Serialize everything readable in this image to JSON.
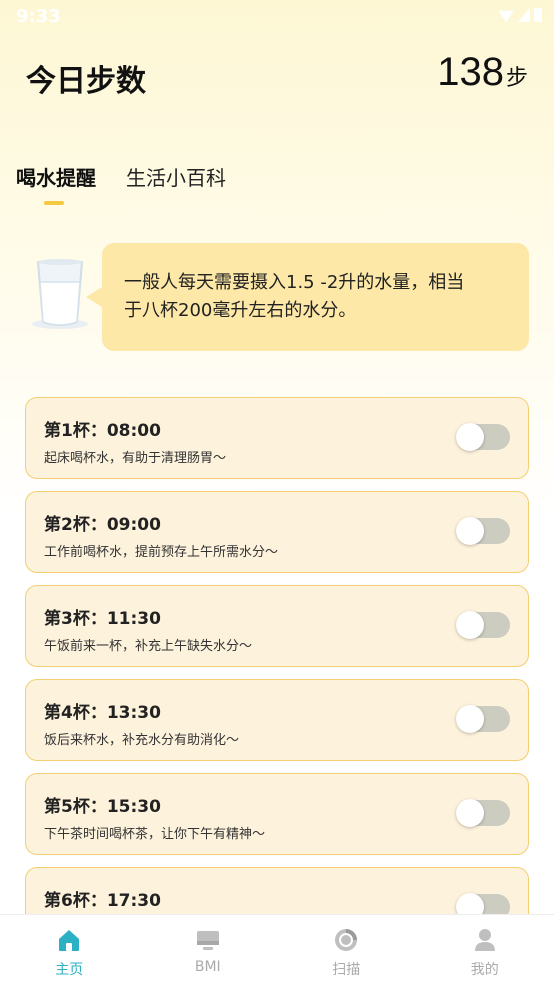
{
  "status_bar": {
    "time": "9:33"
  },
  "header": {
    "title": "今日步数",
    "steps_value": "138",
    "steps_unit": "步"
  },
  "tabs": [
    {
      "label": "喝水提醒",
      "active": true
    },
    {
      "label": "生活小百科",
      "active": false
    }
  ],
  "tip": {
    "line1": "一般人每天需要摄入1.5 -2升的水量，相当",
    "line2": "于八杯200毫升左右的水分。"
  },
  "cups": [
    {
      "title": "第1杯：08:00",
      "desc": "起床喝杯水，有助于清理肠胃～",
      "enabled": false
    },
    {
      "title": "第2杯：09:00",
      "desc": "工作前喝杯水，提前预存上午所需水分～",
      "enabled": false
    },
    {
      "title": "第3杯：11:30",
      "desc": "午饭前来一杯，补充上午缺失水分～",
      "enabled": false
    },
    {
      "title": "第4杯：13:30",
      "desc": "饭后来杯水，补充水分有助消化～",
      "enabled": false
    },
    {
      "title": "第5杯：15:30",
      "desc": "下午茶时间喝杯茶，让你下午有精神～",
      "enabled": false
    },
    {
      "title": "第6杯：17:30",
      "desc": "",
      "enabled": false
    }
  ],
  "nav": [
    {
      "label": "主页",
      "icon": "home-icon",
      "active": true
    },
    {
      "label": "BMI",
      "icon": "monitor-icon",
      "active": false
    },
    {
      "label": "扫描",
      "icon": "scan-icon",
      "active": false
    },
    {
      "label": "我的",
      "icon": "user-icon",
      "active": false
    }
  ],
  "colors": {
    "accent": "#2bb0c4",
    "highlight": "#f5c842",
    "bubble": "#fde8a8",
    "card_bg": "#fdf2dc",
    "card_border": "#f3cf72"
  }
}
